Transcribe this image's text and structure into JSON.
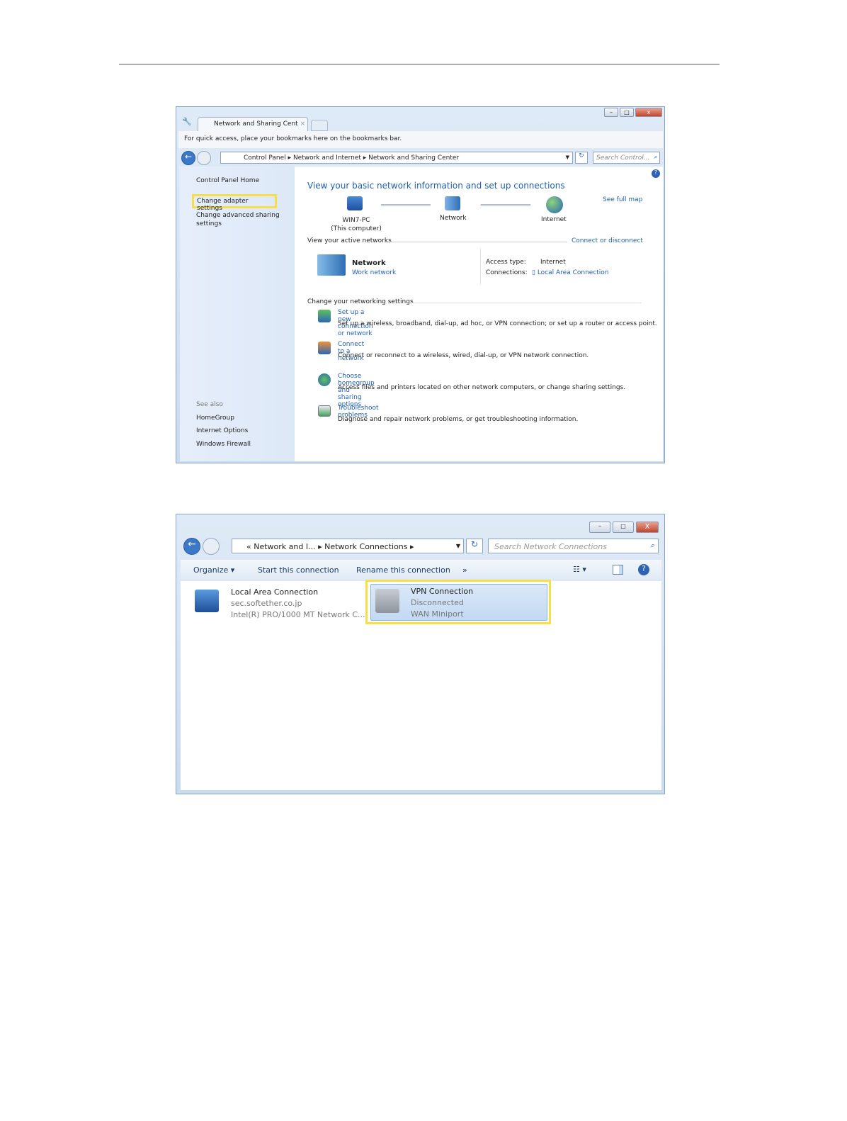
{
  "shot1": {
    "tab_title": "Network and Sharing Cent",
    "bookmarks_bar": "For quick access, place your bookmarks here on the bookmarks bar.",
    "breadcrumb": [
      "Control Panel",
      "Network and Internet",
      "Network and Sharing Center"
    ],
    "search_placeholder": "Search Control...",
    "sidebar": {
      "home": "Control Panel Home",
      "items": [
        "Change adapter settings",
        "Change advanced sharing settings"
      ],
      "see_also": "See also",
      "see_also_items": [
        "HomeGroup",
        "Internet Options",
        "Windows Firewall"
      ]
    },
    "heading": "View your basic network information and set up connections",
    "see_full_map": "See full map",
    "map": {
      "computer": "WIN7-PC",
      "computer_sub": "(This computer)",
      "network": "Network",
      "internet": "Internet"
    },
    "active_networks_label": "View your active networks",
    "connect_or_disconnect": "Connect or disconnect",
    "active_network": {
      "name": "Network",
      "type": "Work network",
      "access_type_label": "Access type:",
      "access_type": "Internet",
      "connections_label": "Connections:",
      "connection": "Local Area Connection"
    },
    "change_settings_label": "Change your networking settings",
    "tasks": [
      {
        "title": "Set up a new connection or network",
        "desc": "Set up a wireless, broadband, dial-up, ad hoc, or VPN connection; or set up a router or access point."
      },
      {
        "title": "Connect to a network",
        "desc": "Connect or reconnect to a wireless, wired, dial-up, or VPN network connection."
      },
      {
        "title": "Choose homegroup and sharing options",
        "desc": "Access files and printers located on other network computers, or change sharing settings."
      },
      {
        "title": "Troubleshoot problems",
        "desc": "Diagnose and repair network problems, or get troubleshooting information."
      }
    ]
  },
  "shot2": {
    "breadcrumb": [
      "«",
      "Network and I...",
      "Network Connections"
    ],
    "search_placeholder": "Search Network Connections",
    "toolbar": {
      "organize": "Organize",
      "start": "Start this connection",
      "rename": "Rename this connection",
      "more": "»"
    },
    "connections": [
      {
        "name": "Local Area Connection",
        "status": "sec.softether.co.jp",
        "device": "Intel(R) PRO/1000 MT Network C..."
      },
      {
        "name": "VPN Connection",
        "status": "Disconnected",
        "device": "WAN Miniport"
      }
    ]
  },
  "colors": {
    "highlight": "#f5e04a",
    "link": "#1e5fb4"
  }
}
